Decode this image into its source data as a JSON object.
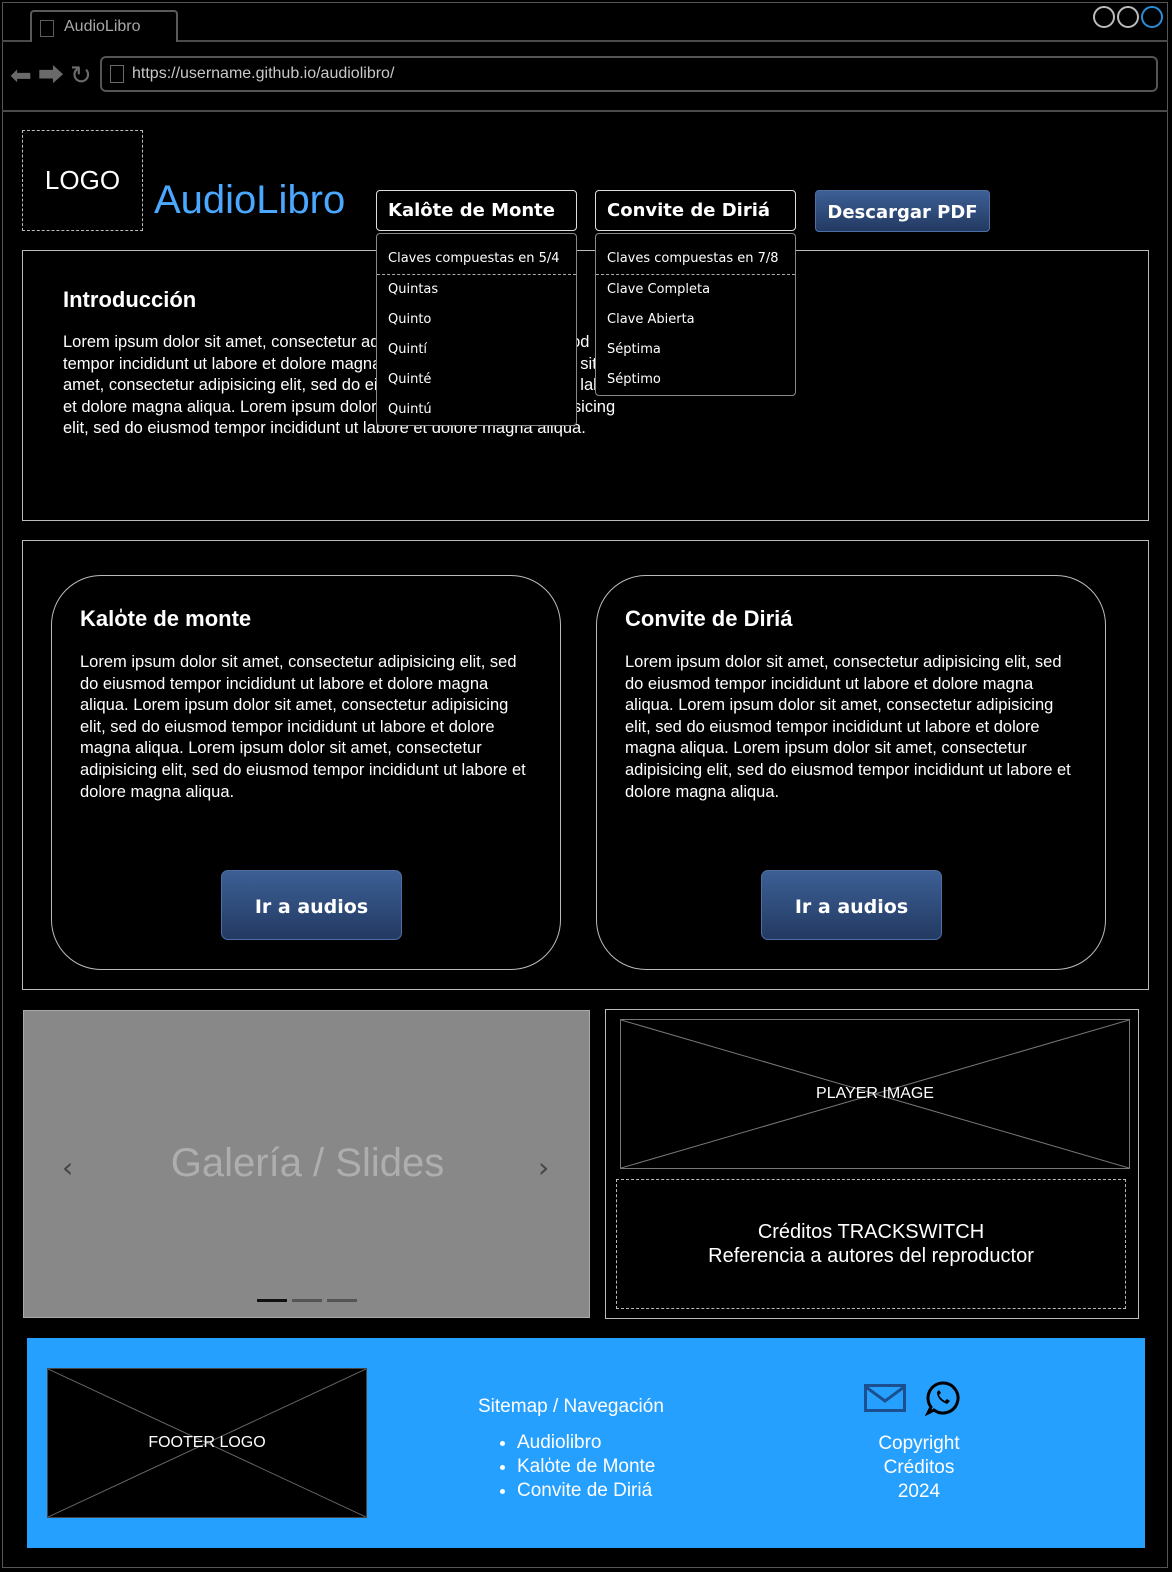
{
  "browser": {
    "tab_title": "AudioLibro",
    "url": "https://username.github.io/audiolibro/"
  },
  "header": {
    "logo": "LOGO",
    "brand": "AudioLibro",
    "download_pdf": "Descargar PDF",
    "dropdowns": [
      {
        "label": "Kalôte de Monte",
        "items": [
          "Claves compuestas en 5/4",
          "Quintas",
          "Quinto",
          "Quintí",
          "Quinté",
          "Quintú"
        ]
      },
      {
        "label": "Convite de Diriá",
        "items": [
          "Claves compuestas en 7/8",
          "Clave Completa",
          "Clave Abierta",
          "Séptima",
          "Séptimo"
        ]
      }
    ]
  },
  "intro": {
    "title": "Introducción",
    "text": "Lorem ipsum dolor sit amet, consectetur adipisicing elit, sed do eiusmod tempor incididunt ut labore et dolore magna aliqua. Lorem ipsum dolor sit amet, consectetur adipisicing elit, sed do eiusmod tempor incididunt ut labore et dolore magna aliqua. Lorem ipsum dolor sit amet, consectetur adipisicing elit, sed do eiusmod tempor incididunt ut labore et dolore magna aliqua."
  },
  "cards": [
    {
      "title": "Kalo̍te de monte",
      "text": "Lorem ipsum dolor sit amet, consectetur adipisicing elit, sed do eiusmod tempor incididunt ut labore et dolore magna aliqua. Lorem ipsum dolor sit amet, consectetur adipisicing elit, sed do eiusmod tempor incididunt ut labore et dolore magna aliqua. Lorem ipsum dolor sit amet, consectetur adipisicing elit, sed do eiusmod tempor incididunt ut labore et dolore magna aliqua.",
      "button": "Ir a audios"
    },
    {
      "title": "Convite de Diriá",
      "text": "Lorem ipsum dolor sit amet, consectetur adipisicing elit, sed do eiusmod tempor incididunt ut labore et dolore magna aliqua. Lorem ipsum dolor sit amet, consectetur adipisicing elit, sed do eiusmod tempor incididunt ut labore et dolore magna aliqua. Lorem ipsum dolor sit amet, consectetur adipisicing elit, sed do eiusmod tempor incididunt ut labore et dolore magna aliqua.",
      "button": "Ir a audios"
    }
  ],
  "gallery": {
    "title": "Galería / Slides",
    "prev": "‹",
    "next": "›"
  },
  "player": {
    "image_label": "PLAYER IMAGE",
    "credits_line1": "Créditos TRACKSWITCH",
    "credits_line2": "Referencia a autores del reproductor"
  },
  "footer": {
    "logo_label": "FOOTER LOGO",
    "sitemap_title": "Sitemap / Navegación",
    "sitemap_items": [
      "Audiolibro",
      "Kalo̍te de Monte",
      "Convite de Diriá"
    ],
    "copyright": "Copyright",
    "credits": "Créditos",
    "year": "2024"
  },
  "colors": {
    "brand": "#4aa9ff",
    "footer_bg": "#26a0ff",
    "button_top": "#3c5f95",
    "button_bottom": "#233a62",
    "gallery_bg": "#888888"
  }
}
